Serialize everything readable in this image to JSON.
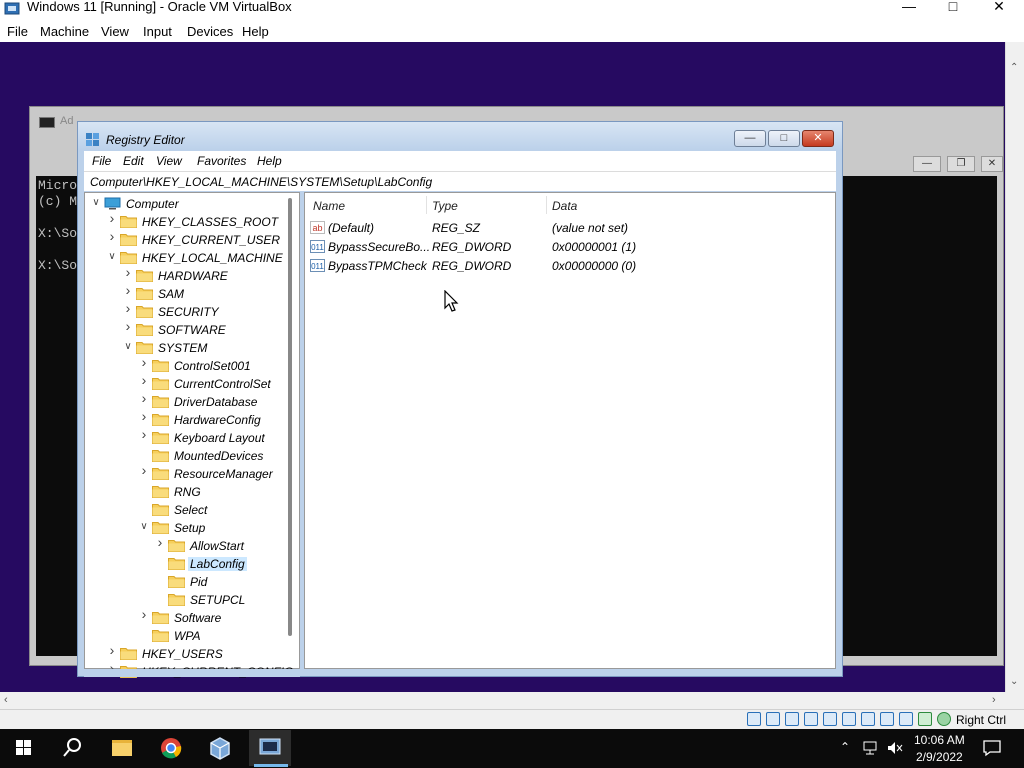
{
  "host": {
    "window_title": "Windows 11 [Running] - Oracle VM VirtualBox",
    "menu": [
      "File",
      "Machine",
      "View",
      "Input",
      "Devices",
      "Help"
    ],
    "status_host_key": "Right Ctrl"
  },
  "console": {
    "title": "Ad",
    "lines": [
      "Micro",
      "(c) M",
      "",
      "X:\\So",
      "",
      "X:\\So"
    ]
  },
  "regedit": {
    "title": "Registry Editor",
    "menu": [
      "File",
      "Edit",
      "View",
      "Favorites",
      "Help"
    ],
    "address": "Computer\\HKEY_LOCAL_MACHINE\\SYSTEM\\Setup\\LabConfig",
    "tree": [
      {
        "label": "Computer",
        "depth": 0,
        "expander": "open",
        "icon": "computer-icon"
      },
      {
        "label": "HKEY_CLASSES_ROOT",
        "depth": 1,
        "expander": "closed"
      },
      {
        "label": "HKEY_CURRENT_USER",
        "depth": 1,
        "expander": "closed"
      },
      {
        "label": "HKEY_LOCAL_MACHINE",
        "depth": 1,
        "expander": "open"
      },
      {
        "label": "HARDWARE",
        "depth": 2,
        "expander": "closed"
      },
      {
        "label": "SAM",
        "depth": 2,
        "expander": "closed"
      },
      {
        "label": "SECURITY",
        "depth": 2,
        "expander": "closed"
      },
      {
        "label": "SOFTWARE",
        "depth": 2,
        "expander": "closed"
      },
      {
        "label": "SYSTEM",
        "depth": 2,
        "expander": "open"
      },
      {
        "label": "ControlSet001",
        "depth": 3,
        "expander": "closed"
      },
      {
        "label": "CurrentControlSet",
        "depth": 3,
        "expander": "closed"
      },
      {
        "label": "DriverDatabase",
        "depth": 3,
        "expander": "closed"
      },
      {
        "label": "HardwareConfig",
        "depth": 3,
        "expander": "closed"
      },
      {
        "label": "Keyboard Layout",
        "depth": 3,
        "expander": "closed"
      },
      {
        "label": "MountedDevices",
        "depth": 3,
        "expander": "none"
      },
      {
        "label": "ResourceManager",
        "depth": 3,
        "expander": "closed"
      },
      {
        "label": "RNG",
        "depth": 3,
        "expander": "none"
      },
      {
        "label": "Select",
        "depth": 3,
        "expander": "none"
      },
      {
        "label": "Setup",
        "depth": 3,
        "expander": "open"
      },
      {
        "label": "AllowStart",
        "depth": 4,
        "expander": "closed"
      },
      {
        "label": "LabConfig",
        "depth": 4,
        "expander": "none",
        "selected": true
      },
      {
        "label": "Pid",
        "depth": 4,
        "expander": "none"
      },
      {
        "label": "SETUPCL",
        "depth": 4,
        "expander": "none"
      },
      {
        "label": "Software",
        "depth": 3,
        "expander": "closed"
      },
      {
        "label": "WPA",
        "depth": 3,
        "expander": "none"
      },
      {
        "label": "HKEY_USERS",
        "depth": 1,
        "expander": "closed"
      },
      {
        "label": "HKEY_CURRENT_CONFIG",
        "depth": 1,
        "expander": "closed"
      }
    ],
    "columns": [
      "Name",
      "Type",
      "Data"
    ],
    "values": [
      {
        "name": "(Default)",
        "type": "REG_SZ",
        "data": "(value not set)",
        "icon": "string-value-icon"
      },
      {
        "name": "BypassSecureBo...",
        "type": "REG_DWORD",
        "data": "0x00000001 (1)",
        "icon": "dword-value-icon"
      },
      {
        "name": "BypassTPMCheck",
        "type": "REG_DWORD",
        "data": "0x00000000 (0)",
        "icon": "dword-value-icon"
      }
    ]
  },
  "taskbar": {
    "time": "10:06 AM",
    "date": "2/9/2022"
  },
  "colors": {
    "guest_background": "#260a61",
    "selection": "#cce8ff",
    "regedit_frame": "#bcd1ea",
    "taskbar": "#0b0b0b",
    "active_indicator": "#76b9ed"
  }
}
